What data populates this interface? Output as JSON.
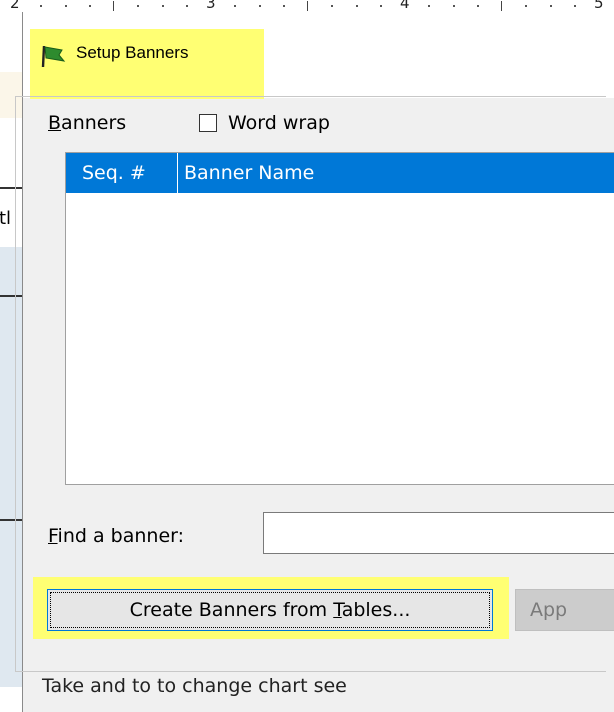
{
  "ruler": {
    "numbers": [
      "2",
      "3",
      "4",
      "5"
    ]
  },
  "background": {
    "partial_text": "ıtl"
  },
  "dialog": {
    "title": "Setup Banners",
    "banners_label_accel": "B",
    "banners_label_rest": "anners",
    "word_wrap": {
      "label": "Word wrap",
      "checked": false
    },
    "list": {
      "columns": [
        "Seq. #",
        "Banner Name"
      ],
      "rows": []
    },
    "find": {
      "label_accel": "F",
      "label_rest": "ind a banner:",
      "value": ""
    },
    "create_button": {
      "label_before": "Create Banners from ",
      "label_accel": "T",
      "label_after": "ables..."
    },
    "apply_button": {
      "label": "App"
    },
    "bottom_partial_text": "Take  and  to  to  change  chart  see"
  },
  "colors": {
    "header_blue": "#0078d7",
    "highlight_yellow": "#ffff73",
    "dialog_bg": "#f0f0f0"
  }
}
